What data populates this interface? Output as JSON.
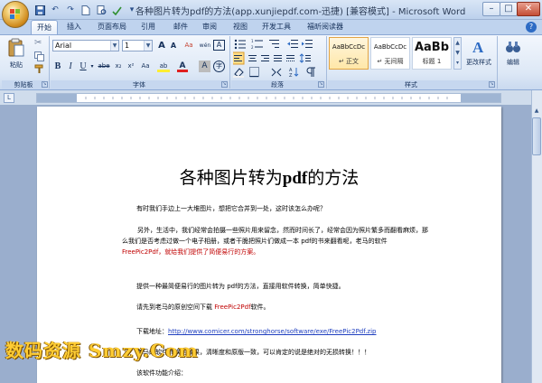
{
  "window": {
    "title": "各种图片转为pdf的方法(app.xunjiepdf.com-迅捷) [兼容模式] - Microsoft Word",
    "min": "–",
    "max": "□",
    "close": "✕"
  },
  "qat": {
    "save": "save-icon",
    "undo": "↶",
    "redo": "↷",
    "more": "▾"
  },
  "tabs": [
    "开始",
    "插入",
    "页面布局",
    "引用",
    "邮件",
    "审阅",
    "视图",
    "开发工具",
    "福昕阅读器"
  ],
  "help": "?",
  "ribbon": {
    "clipboard": {
      "label": "剪贴板",
      "paste": "粘贴"
    },
    "font": {
      "label": "字体",
      "font_name": "Arial",
      "font_size": "1",
      "grow": "A",
      "shrink": "A",
      "clear": "Aa",
      "phonetic": "wén",
      "border": "A",
      "bold": "B",
      "italic": "I",
      "underline": "U",
      "strike": "abe",
      "sub": "x₂",
      "sup": "x²",
      "case": "Aa",
      "highlight": "ab",
      "color": "A",
      "shade": "A",
      "enclose": "字"
    },
    "paragraph": {
      "label": "段落"
    },
    "styles": {
      "label": "样式",
      "items": [
        {
          "sample": "AaBbCcDc",
          "name": "↵ 正文"
        },
        {
          "sample": "AaBbCcDc",
          "name": "↵ 无间隔"
        },
        {
          "sample": "AaBb",
          "name": "标题 1"
        }
      ],
      "change": "更改样式"
    },
    "editing": {
      "label": "编辑"
    }
  },
  "document": {
    "title_pre": "各种图片转为",
    "title_bold": "pdf",
    "title_post": "的方法",
    "p1": "有时我们手边上一大堆图片，想把它合并到一处，这时该怎么办呢？",
    "p2_a": "另外，生活中，我们经常会拍摄一些照片用来留念，然而时间长了，经常会因为照片繁多而翻看麻烦，那么我们是否考虑过做一个电子相册，或者干脆把照片们做成一本 pdf的书来翻看呢，",
    "p2_b": "老马的软件",
    "p2_red": "FreePic2Pdf，就给我们提供了简便易行的方案。",
    "p3": "提供一种最简便易行的图片转为 pdf的方法，直接用软件转换，简单快捷。",
    "p4_a": "请先到老马的原创空间下载 ",
    "p4_red": "FreePic2Pdf",
    "p4_b": "软件。",
    "p5_a": "下载地址：",
    "p5_link": "http://www.comicer.com/stronghorse/software/exe/FreePic2Pdf.zip",
    "p6": "老马的软件转换的效果，清晰度和原版一致，可以肯定的说是绝对的无损转换！！！",
    "p7": "该软件功能介绍："
  },
  "watermark": "数码资源 Smzy.Com"
}
